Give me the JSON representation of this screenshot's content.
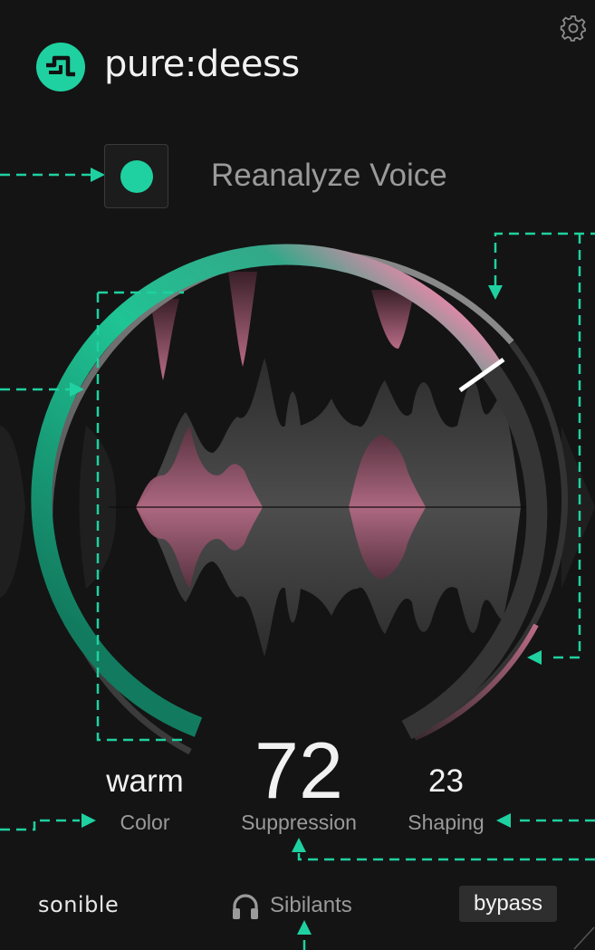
{
  "app": {
    "title": "pure:deess",
    "logo_icon": "sonible-s-logo-icon"
  },
  "colors": {
    "accent": "#1fd1a0",
    "sibilant": "#b86b86",
    "background": "#141414",
    "text_primary": "#f2f2f2",
    "text_secondary": "#9a9a9a"
  },
  "header": {
    "settings_icon": "gear-icon"
  },
  "reanalyze": {
    "label": "Reanalyze Voice",
    "indicator_color": "#1fd1a0"
  },
  "dial": {
    "suppression_level": 0.72
  },
  "controls": {
    "color": {
      "value": "warm",
      "label": "Color"
    },
    "suppression": {
      "value": "72",
      "label": "Suppression"
    },
    "shaping": {
      "value": "23",
      "label": "Shaping"
    }
  },
  "footer": {
    "brand": "sonible",
    "sibilants_label": "Sibilants",
    "sibilants_icon": "headphones-icon",
    "bypass_label": "bypass"
  }
}
